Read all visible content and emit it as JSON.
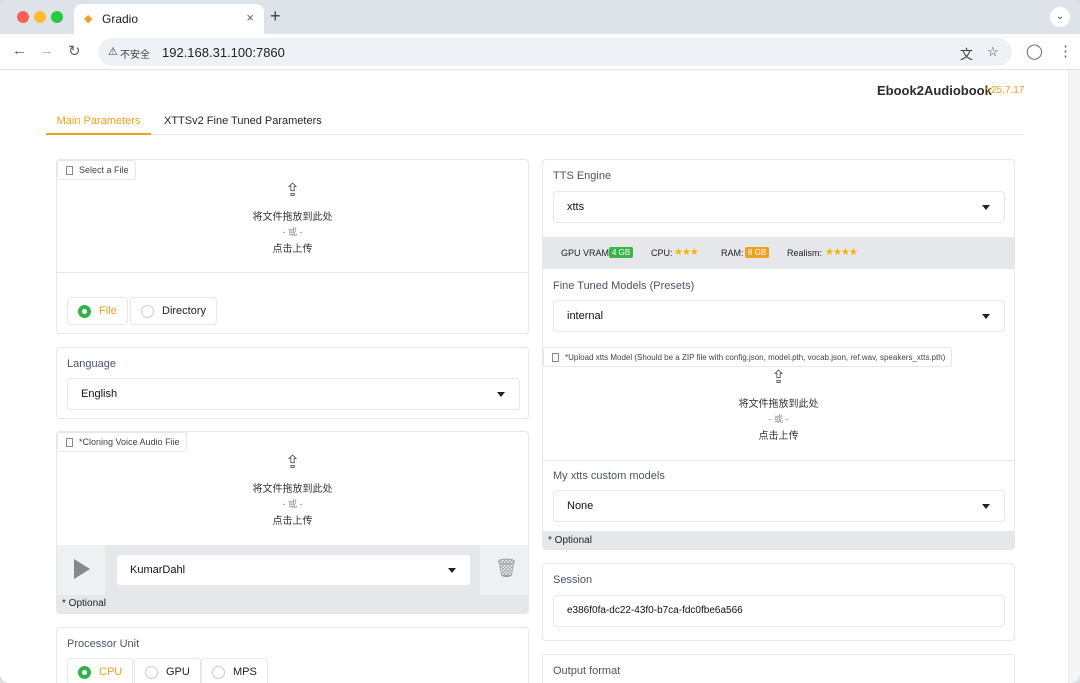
{
  "browser": {
    "tab_title": "Gradio",
    "tab_close": "×",
    "new_tab": "+",
    "tab_menu": "⌄",
    "insecure_label": "不安全",
    "url": "192.168.31.100:7860"
  },
  "app": {
    "title": "Ebook2Audiobook",
    "version": "v25.7.17"
  },
  "tabs": [
    "Main Parameters",
    "XTTSv2 Fine Tuned Parameters"
  ],
  "upload_text": {
    "line1": "将文件拖放到此处",
    "line2": "- 或 -",
    "line3": "点击上传"
  },
  "left": {
    "file_upload_label": "Select a File",
    "mode_options": [
      "File",
      "Directory"
    ],
    "mode_selected": "File",
    "language_label": "Language",
    "language_value": "English",
    "voice_label": "*Cloning Voice Audio Fiie",
    "voice_select_value": "KumarDahl",
    "voice_optional": "* Optional",
    "processor_label": "Processor Unit",
    "processor_options": [
      "CPU",
      "GPU",
      "MPS"
    ],
    "processor_selected": "CPU"
  },
  "right": {
    "engine_label": "TTS Engine",
    "engine_value": "xtts",
    "specs": {
      "vram_label": "GPU VRAM:",
      "vram_value": "4 GB",
      "vram_color": "#3bb54a",
      "cpu_label": "CPU:",
      "cpu_stars": "★★★",
      "ram_label": "RAM:",
      "ram_value": "8 GB",
      "ram_color": "#f0a020",
      "realism_label": "Realism:",
      "realism_stars": "★★★★"
    },
    "fine_tuned_label": "Fine Tuned Models (Presets)",
    "fine_tuned_value": "internal",
    "upload_model_label": "*Upload xtts Model (Should be a ZIP file with config.json, model.pth, vocab.json, ref.wav, speakers_xtts.pth)",
    "custom_models_label": "My xtts custom models",
    "custom_models_value": "None",
    "optional": "* Optional",
    "session_label": "Session",
    "session_value": "e386f0fa-dc22-43f0-b7ca-fdc0fbe6a566",
    "output_format_label": "Output format"
  },
  "colors": {
    "accent": "#f0a020",
    "radio_green": "#2fb34a"
  }
}
